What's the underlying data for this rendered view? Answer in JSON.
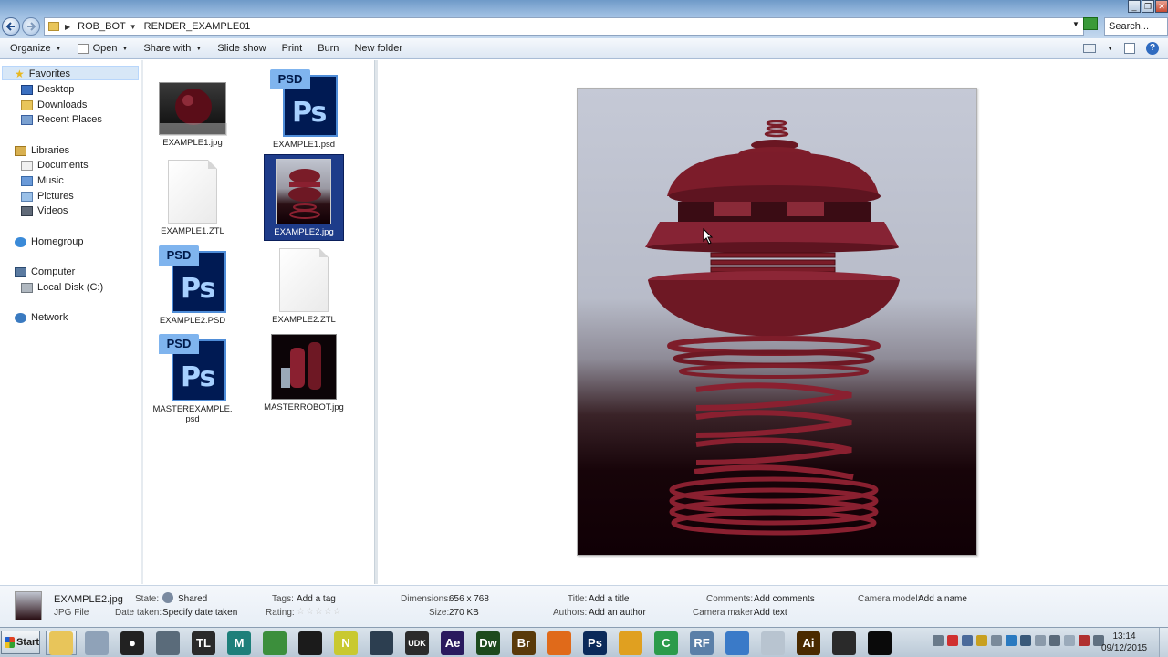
{
  "addressbar": {
    "crumbs": [
      "ROB_BOT",
      "RENDER_EXAMPLE01"
    ],
    "search_placeholder": "Search..."
  },
  "toolbar": {
    "organize": "Organize",
    "open": "Open",
    "share_with": "Share with",
    "slide_show": "Slide show",
    "print": "Print",
    "burn": "Burn",
    "new_folder": "New folder"
  },
  "nav": {
    "favorites": "Favorites",
    "desktop": "Desktop",
    "downloads": "Downloads",
    "recent": "Recent Places",
    "libraries": "Libraries",
    "documents": "Documents",
    "music": "Music",
    "pictures": "Pictures",
    "videos": "Videos",
    "homegroup": "Homegroup",
    "computer": "Computer",
    "localdisk": "Local Disk (C:)",
    "network": "Network"
  },
  "files": [
    {
      "name": "EXAMPLE1.jpg"
    },
    {
      "name": "EXAMPLE1.psd"
    },
    {
      "name": "EXAMPLE1.ZTL"
    },
    {
      "name": "EXAMPLE2.jpg"
    },
    {
      "name": "EXAMPLE2.PSD"
    },
    {
      "name": "EXAMPLE2.ZTL"
    },
    {
      "name": "MASTEREXAMPLE.psd"
    },
    {
      "name": "MASTERROBOT.jpg"
    }
  ],
  "psd_tab": "PSD",
  "psd_glyph": "Ps",
  "details": {
    "filename": "EXAMPLE2.jpg",
    "filetype": "JPG File",
    "state_label": "State:",
    "state_value": "Shared",
    "date_label": "Date taken:",
    "date_value": "Specify date taken",
    "tags_label": "Tags:",
    "tags_value": "Add a tag",
    "rating_label": "Rating:",
    "rating_stars": "☆☆☆☆☆",
    "dim_label": "Dimensions:",
    "dim_value": "656 x 768",
    "size_label": "Size:",
    "size_value": "270 KB",
    "title_label": "Title:",
    "title_value": "Add a title",
    "authors_label": "Authors:",
    "authors_value": "Add an author",
    "comments_label": "Comments:",
    "comments_value": "Add comments",
    "cammaker_label": "Camera maker:",
    "cammaker_value": "Add text",
    "cammodel_label": "Camera model:",
    "cammodel_value": "Add a name"
  },
  "taskbar": {
    "start": "Start",
    "time": "13:14",
    "date": "09/12/2015",
    "apps": [
      {
        "name": "explorer",
        "glyph": "",
        "color": "#e8c55a"
      },
      {
        "name": "network-tool",
        "glyph": "",
        "color": "#8fa2b8"
      },
      {
        "name": "record",
        "glyph": "●",
        "color": "#222222"
      },
      {
        "name": "cinema",
        "glyph": "",
        "color": "#5a6b7a"
      },
      {
        "name": "tl",
        "glyph": "TL",
        "color": "#2a2a2a"
      },
      {
        "name": "maya",
        "glyph": "M",
        "color": "#1e7f7a"
      },
      {
        "name": "chrome",
        "glyph": "",
        "color": "#3c8f3c"
      },
      {
        "name": "marmoset",
        "glyph": "",
        "color": "#1b1b1b"
      },
      {
        "name": "nuke",
        "glyph": "N",
        "color": "#c9c930"
      },
      {
        "name": "ue",
        "glyph": "",
        "color": "#2c3e50"
      },
      {
        "name": "udk",
        "glyph": "UDK",
        "color": "#2b2b2b"
      },
      {
        "name": "after-effects",
        "glyph": "Ae",
        "color": "#2a1a5e"
      },
      {
        "name": "dreamweaver",
        "glyph": "Dw",
        "color": "#1d4a1d"
      },
      {
        "name": "bridge",
        "glyph": "Br",
        "color": "#5a3a0a"
      },
      {
        "name": "firefox",
        "glyph": "",
        "color": "#e06a1a"
      },
      {
        "name": "photoshop",
        "glyph": "Ps",
        "color": "#0b2a5a"
      },
      {
        "name": "audio",
        "glyph": "",
        "color": "#e0a020"
      },
      {
        "name": "camtasia",
        "glyph": "C",
        "color": "#2b9b4a"
      },
      {
        "name": "realflow",
        "glyph": "RF",
        "color": "#5a7fa8"
      },
      {
        "name": "settings-app",
        "glyph": "",
        "color": "#3a7ac8"
      },
      {
        "name": "zbrush",
        "glyph": "",
        "color": "#b8c4d0"
      },
      {
        "name": "illustrator",
        "glyph": "Ai",
        "color": "#4a2a00"
      },
      {
        "name": "unity",
        "glyph": "",
        "color": "#2a2a2a"
      },
      {
        "name": "studio",
        "glyph": "",
        "color": "#0a0a0a"
      }
    ]
  },
  "colors": {
    "selection": "#1e3c8a",
    "robot_red": "#8a2030"
  }
}
